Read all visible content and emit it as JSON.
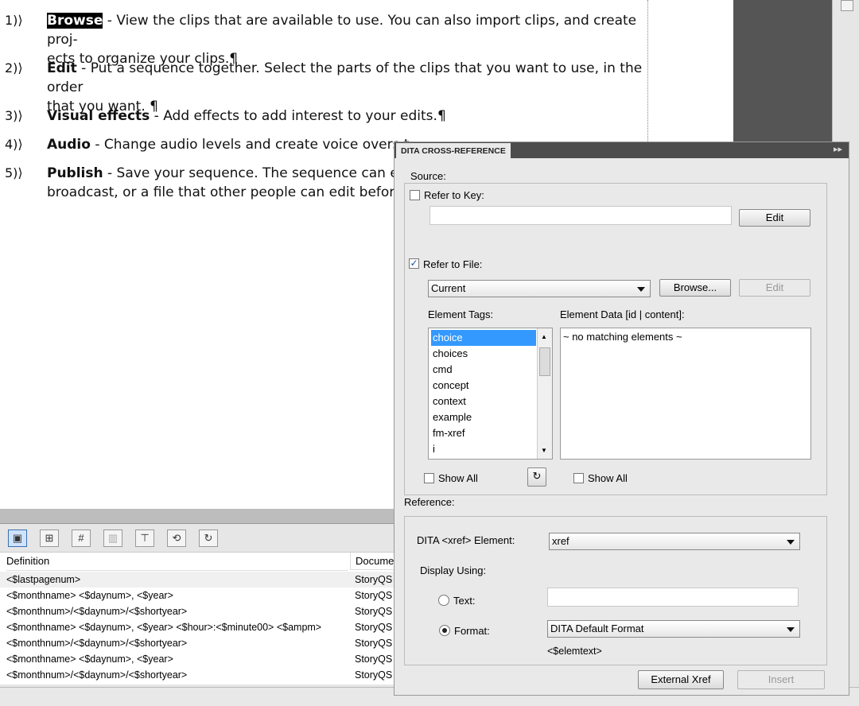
{
  "document": {
    "items": [
      {
        "num": "1)⟩",
        "term": "Browse",
        "line1": " - View the clips that are available to use. You can also import clips, and create proj-",
        "line2": "ects to organize your clips.¶"
      },
      {
        "num": "2)⟩",
        "term": "Edit",
        "line1": " - Put a sequence together. Select the parts of the clips that you want to use, in the order",
        "line2": "that you want. ¶"
      },
      {
        "num": "3)⟩",
        "term": "Visual effects",
        "line1": " - Add effects to add interest to your edits.¶",
        "line2": ""
      },
      {
        "num": "4)⟩",
        "term": "Audio",
        "line1": " - Change audio levels and create voice overs t",
        "line2": ""
      },
      {
        "num": "5)⟩",
        "term": "Publish",
        "line1": " - Save your sequence. The sequence can eith",
        "line2": "broadcast, or a file that other people can edit before"
      }
    ]
  },
  "variables_panel": {
    "columns": [
      "Definition",
      "Docume"
    ],
    "rows": [
      {
        "definition": "<$lastpagenum>",
        "document": "StoryQS"
      },
      {
        "definition": "<$monthname> <$daynum>, <$year>",
        "document": "StoryQS"
      },
      {
        "definition": "<$monthnum>/<$daynum>/<$shortyear>",
        "document": "StoryQS"
      },
      {
        "definition": "<$monthname> <$daynum>, <$year> <$hour>:<$minute00> <$ampm>",
        "document": "StoryQS"
      },
      {
        "definition": "<$monthnum>/<$daynum>/<$shortyear>",
        "document": "StoryQS"
      },
      {
        "definition": "<$monthname> <$daynum>, <$year>",
        "document": "StoryQS"
      },
      {
        "definition": "<$monthnum>/<$daynum>/<$shortyear>",
        "document": "StoryQS"
      }
    ],
    "toolbar_icons": [
      "new-variable-icon",
      "add-variable-icon",
      "edit-variable-icon",
      "delete-variable-icon",
      "convert-to-text-icon",
      "update-icon",
      "refresh-icon"
    ]
  },
  "dialog": {
    "title": "DITA CROSS-REFERENCE",
    "source_label": "Source:",
    "refer_to_key": {
      "label": "Refer to Key:",
      "checked": false,
      "value": "",
      "edit": "Edit"
    },
    "refer_to_file": {
      "label": "Refer to File:",
      "checked": true,
      "file": "Current",
      "browse": "Browse...",
      "edit": "Edit"
    },
    "element_tags_label": "Element Tags:",
    "element_tags": [
      "choice",
      "choices",
      "cmd",
      "concept",
      "context",
      "example",
      "fm-xref",
      "i"
    ],
    "selected_tag": "choice",
    "element_data_label": "Element Data [id | content]:",
    "element_data_text": "~ no matching elements ~",
    "show_all_tags": "Show All",
    "show_all_data": "Show All",
    "reference_label": "Reference:",
    "xref_element_label": "DITA <xref> Element:",
    "xref_element_value": "xref",
    "display_using_label": "Display Using:",
    "text_option": "Text:",
    "text_value": "",
    "format_option": "Format:",
    "format_value": "DITA Default Format",
    "format_preview": "<$elemtext>",
    "external_xref": "External Xref",
    "insert": "Insert"
  },
  "colors": {
    "selection": "#3399ff",
    "dialog_title_bar": "#4d4d4d",
    "highlight": "#000000"
  }
}
